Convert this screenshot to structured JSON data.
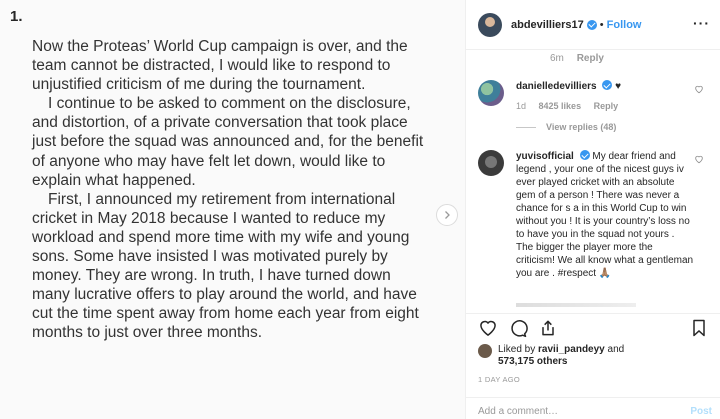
{
  "post": {
    "number": "1.",
    "paragraphs": [
      "Now the Proteas’ World Cup campaign is over, and the team cannot be distracted, I would like to respond to unjustified criticism of me during the tournament.",
      "I continue to be asked to comment on the disclosure, and distortion, of a private conversation that took place just before the squad was announced and, for the benefit of anyone who may have felt let down, would like to explain what happened.",
      "First, I announced my retirement from international cricket in May 2018 because I wanted to reduce my workload and spend more time with my wife and young sons. Some have insisted I was motivated purely by money. They are wrong. In truth, I have turned down many lucrative offers to play around the world, and have cut the time spent away from home each year from eight months to just over three months."
    ]
  },
  "header": {
    "username": "abdevilliers17",
    "separator": "•",
    "follow_label": "Follow",
    "more_label": "···"
  },
  "partial_comment": {
    "time": "6m",
    "reply_label": "Reply"
  },
  "comments": [
    {
      "username": "danielledevilliers",
      "suffix": "♥",
      "time": "1d",
      "likes": "8425 likes",
      "reply_label": "Reply",
      "view_replies": "View replies (48)"
    },
    {
      "username": "yuvisofficial",
      "text": "My dear friend and legend , your one of the nicest guys iv ever played cricket with an absolute gem of a person ! There was never a chance for s a in this World Cup to win without you ! It is your country’s loss no to have you in the squad not yours . The bigger the player more the criticism! We all know what a gentleman you are . #respect 🙏🏽"
    }
  ],
  "likes": {
    "prefix": "Liked by",
    "user": "ravii_pandeyy",
    "and": "and",
    "count": "573,175 others"
  },
  "timestamp": "1 DAY AGO",
  "add_comment": {
    "placeholder": "Add a comment…",
    "post_label": "Post"
  },
  "colors": {
    "accent": "#3897f0",
    "muted": "#999999",
    "post_disabled": "#b2dffc"
  }
}
